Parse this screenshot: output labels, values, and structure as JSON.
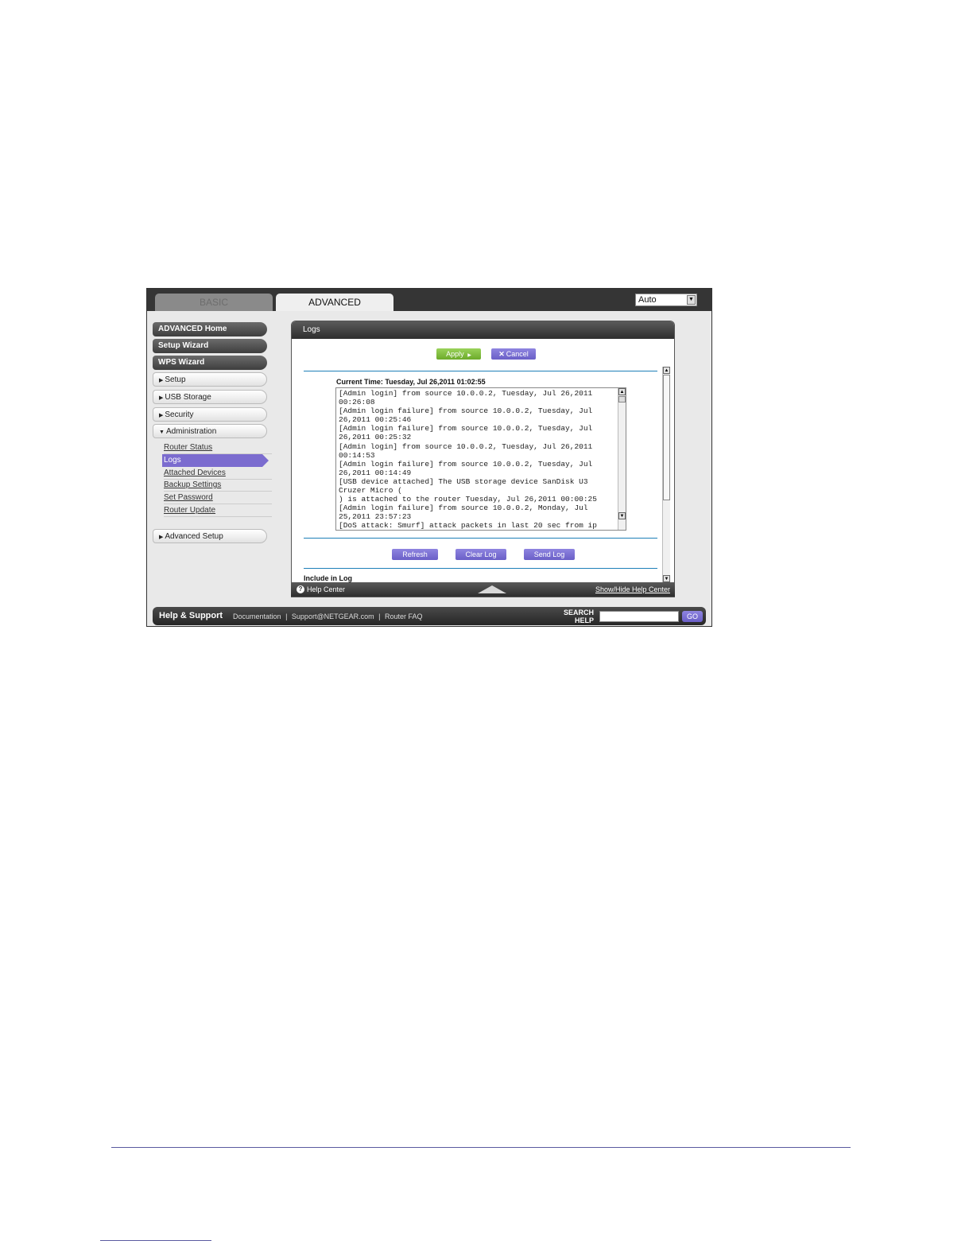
{
  "tabs": {
    "basic": "BASIC",
    "advanced": "ADVANCED"
  },
  "language_select": {
    "value": "Auto"
  },
  "sidebar": {
    "buttons": [
      "ADVANCED Home",
      "Setup Wizard",
      "WPS Wizard"
    ],
    "sections": [
      "Setup",
      "USB Storage",
      "Security",
      "Administration"
    ],
    "admin_links": [
      "Router Status",
      "Logs",
      "Attached Devices",
      "Backup Settings",
      "Set Password",
      "Router Update"
    ],
    "advanced_setup": "Advanced Setup"
  },
  "panel": {
    "title": "Logs",
    "apply_label": "Apply",
    "cancel_label": "Cancel",
    "current_time": "Current Time: Tuesday, Jul 26,2011 01:02:55",
    "log_lines": [
      "[Admin login] from source 10.0.0.2, Tuesday, Jul 26,2011",
      "00:26:08",
      "[Admin login failure] from source 10.0.0.2, Tuesday, Jul",
      "26,2011 00:25:46",
      "[Admin login failure] from source 10.0.0.2, Tuesday, Jul",
      "26,2011 00:25:32",
      "[Admin login] from source 10.0.0.2, Tuesday, Jul 26,2011",
      "00:14:53",
      "[Admin login failure] from source 10.0.0.2, Tuesday, Jul",
      "26,2011 00:14:49",
      "[USB device attached] The USB storage device SanDisk U3",
      "Cruzer Micro (",
      ") is attached to the router Tuesday, Jul 26,2011 00:00:25",
      "[Admin login failure] from source 10.0.0.2, Monday, Jul",
      "25,2011 23:57:23",
      "[DoS attack: Smurf] attack packets in last 20 sec from ip"
    ],
    "refresh_label": "Refresh",
    "clear_log_label": "Clear Log",
    "send_log_label": "Send Log",
    "include_in_log": "Include in Log"
  },
  "help_bar": {
    "help_center": "Help Center",
    "show_hide": "Show/Hide Help Center"
  },
  "footer": {
    "title": "Help & Support",
    "links": [
      "Documentation",
      "|",
      "Support@NETGEAR.com",
      "|",
      "Router FAQ"
    ],
    "search_label_1": "SEARCH",
    "search_label_2": "HELP",
    "go_label": "GO"
  }
}
